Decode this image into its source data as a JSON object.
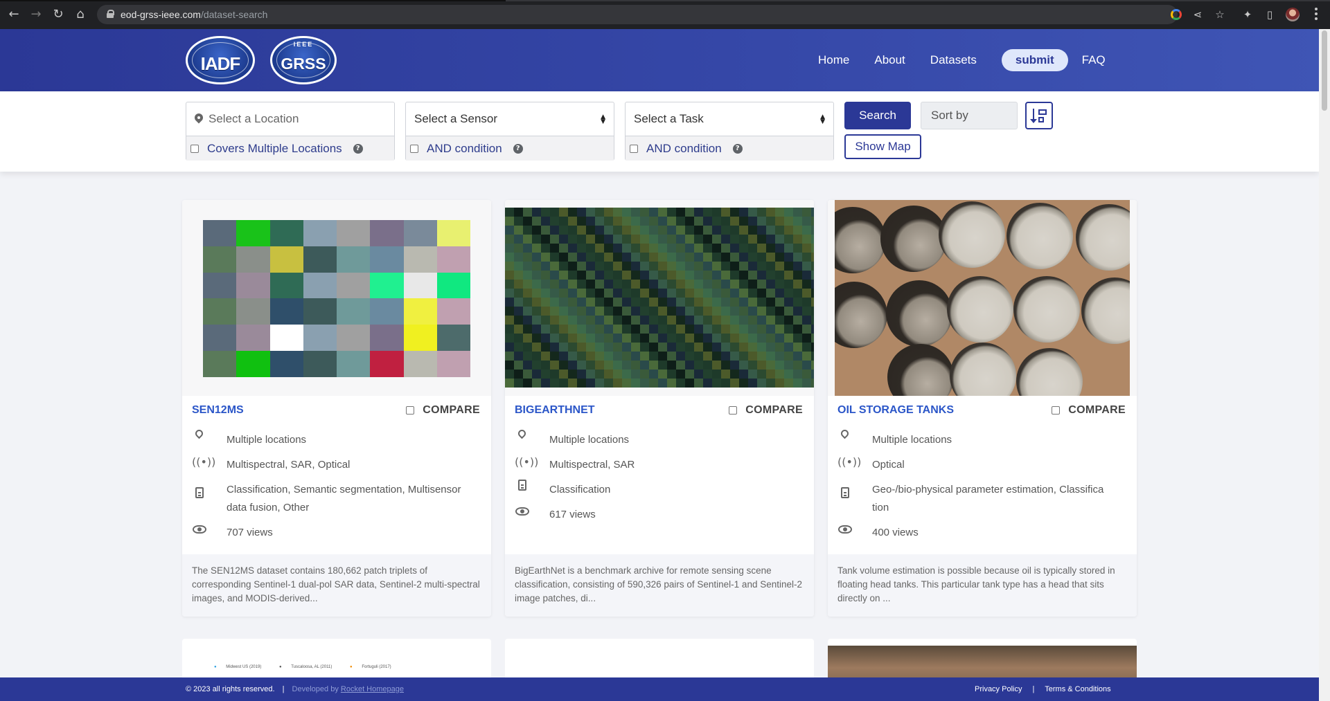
{
  "browser": {
    "url_domain": "eod-grss-ieee.com",
    "url_path": "/dataset-search"
  },
  "header": {
    "logos": [
      "IADF",
      "GRSS"
    ],
    "logo_top_word": "IEEE",
    "nav": {
      "home": "Home",
      "about": "About",
      "datasets": "Datasets",
      "submit": "submit",
      "faq": "FAQ"
    }
  },
  "search": {
    "location_placeholder": "Select a Location",
    "multiple_locations_label": "Covers Multiple Locations",
    "sensor_select": "Select a Sensor",
    "sensor_and_label": "AND condition",
    "task_select": "Select a Task",
    "task_and_label": "AND condition",
    "search_button": "Search",
    "sort_by": "Sort by",
    "show_map_button": "Show Map",
    "help_glyph": "?"
  },
  "cards": [
    {
      "title": "SEN12MS",
      "compare_label": "COMPARE",
      "location": "Multiple locations",
      "sensors": "Multispectral, SAR, Optical",
      "tasks_line1": "Classification, Semantic segmentation, Multisensor",
      "tasks_line2": "data fusion, Other",
      "views": "707 views",
      "description": "The SEN12MS dataset contains 180,662 patch triplets of corresponding Sentinel-1 dual-pol SAR data, Sentinel-2 multi-spectral images, and MODIS-derived..."
    },
    {
      "title": "BIGEARTHNET",
      "compare_label": "COMPARE",
      "location": "Multiple locations",
      "sensors": "Multispectral, SAR",
      "tasks_line1": "Classification",
      "views": "617 views",
      "description": "BigEarthNet is a benchmark archive for remote sensing scene classification, consisting of 590,326 pairs of Sentinel-1 and Sentinel-2 image patches, di..."
    },
    {
      "title": "OIL STORAGE TANKS",
      "compare_label": "COMPARE",
      "location": "Multiple locations",
      "sensors": "Optical",
      "tasks_line1": "Geo-/bio-physical parameter estimation, Classifica",
      "tasks_line2": "tion",
      "views": "400 views",
      "description": "Tank volume estimation is possible because oil is typically stored in floating head tanks. This particular tank type has a head that sits directly on ..."
    }
  ],
  "peek": {
    "legend": [
      "Midwest US (2019)",
      "Tuscaloosa, AL (2011)",
      "Fortuguli (2017)"
    ]
  },
  "footer": {
    "copyright": "© 2023 all rights reserved.",
    "separator": "|",
    "developed_by": "Developed by",
    "developer_link": "Rocket Homepage",
    "privacy": "Privacy Policy",
    "terms": "Terms & Conditions"
  },
  "colors": {
    "brand_blue": "#2b3896",
    "link_blue": "#2b56c8"
  }
}
